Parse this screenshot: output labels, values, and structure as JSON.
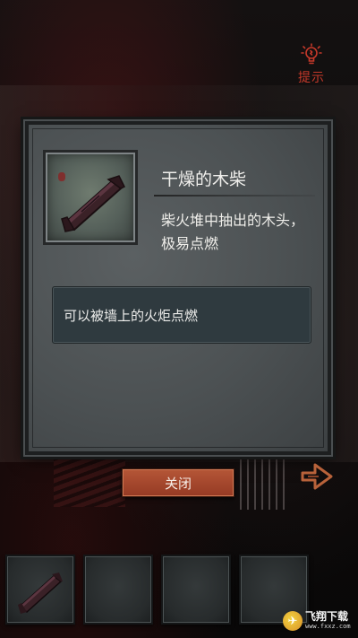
{
  "hint": {
    "label": "提示",
    "icon": "lightbulb-icon"
  },
  "dialog": {
    "item_name": "干燥的木柴",
    "item_description": "柴火堆中抽出的木头，极易点燃",
    "detail_text": "可以被墙上的火炬点燃",
    "item_icon": "firewood-log-icon"
  },
  "close_button": {
    "label": "关闭"
  },
  "next_arrow": {
    "icon": "arrow-right-icon"
  },
  "inventory": {
    "slots": [
      {
        "item": "firewood-log-icon"
      },
      {
        "item": ""
      },
      {
        "item": ""
      },
      {
        "item": ""
      }
    ]
  },
  "watermark": {
    "name": "飞翔下载",
    "url": "www.fxxz.com"
  },
  "colors": {
    "accent_red": "#c4392a",
    "button": "#a8492f",
    "dialog_bg": "#4f5456",
    "detail_bg": "#2f3a3f"
  }
}
